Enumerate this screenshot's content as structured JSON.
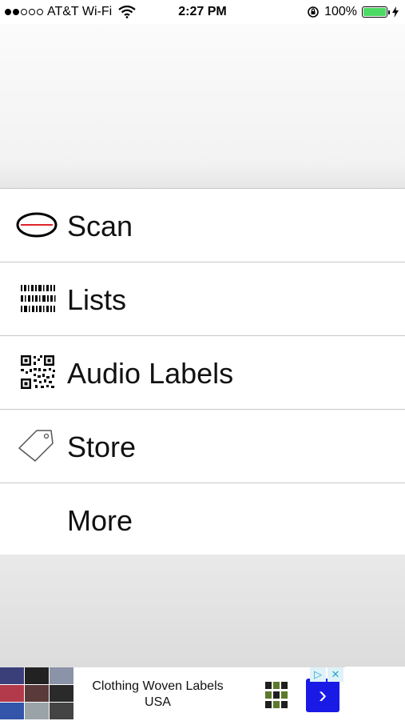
{
  "status_bar": {
    "carrier": "AT&T Wi-Fi",
    "time": "2:27 PM",
    "battery": "100%",
    "signal_dots_filled": 2,
    "signal_dots_total": 5,
    "battery_level": 1.0
  },
  "menu": {
    "items": [
      {
        "label": "Scan",
        "icon": "eye-scan-icon"
      },
      {
        "label": "Lists",
        "icon": "barcode-icon"
      },
      {
        "label": "Audio Labels",
        "icon": "qr-code-icon"
      },
      {
        "label": "Store",
        "icon": "price-tag-icon"
      },
      {
        "label": "More",
        "icon": ""
      }
    ]
  },
  "ad": {
    "title": "Clothing Woven Labels USA",
    "go_symbol": "›",
    "badge_adchoices": "▷",
    "badge_close": "✕"
  },
  "colors": {
    "battery_green": "#4cd964",
    "ad_button": "#1a1ae6",
    "scan_line": "#e0232b"
  }
}
